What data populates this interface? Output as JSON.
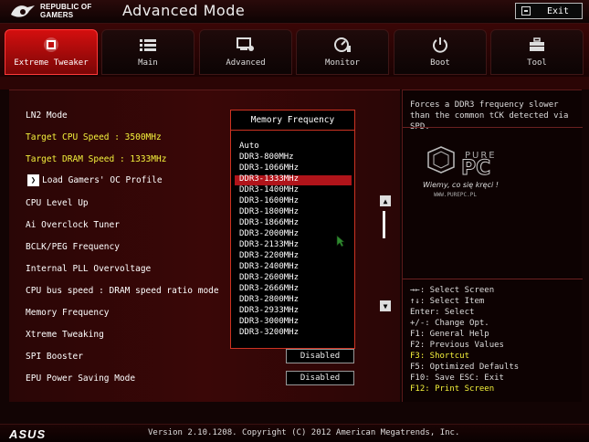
{
  "header": {
    "brand_line1": "REPUBLIC OF",
    "brand_line2": "GAMERS",
    "mode_title": "Advanced Mode",
    "exit_label": "Exit"
  },
  "tabs": [
    {
      "label": "Extreme Tweaker",
      "icon": "cpu-chip-icon",
      "active": true
    },
    {
      "label": "Main",
      "icon": "list-icon"
    },
    {
      "label": "Advanced",
      "icon": "settings-screen-icon"
    },
    {
      "label": "Monitor",
      "icon": "gauge-icon"
    },
    {
      "label": "Boot",
      "icon": "power-icon"
    },
    {
      "label": "Tool",
      "icon": "toolbox-icon"
    }
  ],
  "settings": [
    {
      "label": "LN2 Mode"
    },
    {
      "label": "Target CPU Speed : 3500MHz",
      "highlight": true
    },
    {
      "label": "Target DRAM Speed : 1333MHz",
      "highlight": true
    },
    {
      "label": "Load Gamers' OC Profile",
      "submenu": true
    },
    {
      "label": "CPU Level Up"
    },
    {
      "label": "Ai Overclock Tuner"
    },
    {
      "label": "BCLK/PEG Frequency"
    },
    {
      "label": "Internal PLL Overvoltage"
    },
    {
      "label": "CPU bus speed : DRAM speed ratio mode"
    },
    {
      "label": "Memory Frequency",
      "selected": true
    },
    {
      "label": "Xtreme Tweaking"
    },
    {
      "label": "SPI Booster",
      "value": "Disabled"
    },
    {
      "label": "EPU Power Saving Mode",
      "value": "Disabled"
    }
  ],
  "popup": {
    "title": "Memory Frequency",
    "options": [
      "Auto",
      "DDR3-800MHz",
      "DDR3-1066MHz",
      "DDR3-1333MHz",
      "DDR3-1400MHz",
      "DDR3-1600MHz",
      "DDR3-1800MHz",
      "DDR3-1866MHz",
      "DDR3-2000MHz",
      "DDR3-2133MHz",
      "DDR3-2200MHz",
      "DDR3-2400MHz",
      "DDR3-2600MHz",
      "DDR3-2666MHz",
      "DDR3-2800MHz",
      "DDR3-2933MHz",
      "DDR3-3000MHz",
      "DDR3-3200MHz"
    ],
    "highlighted": "DDR3-1333MHz"
  },
  "help": {
    "description": "Forces a DDR3 frequency slower than the common tCK detected via SPD.",
    "keys": [
      {
        "text": "→←: Select Screen"
      },
      {
        "text": "↑↓: Select Item"
      },
      {
        "text": "Enter: Select"
      },
      {
        "text": "+/-: Change Opt."
      },
      {
        "text": "F1: General Help"
      },
      {
        "text": "F2: Previous Values"
      },
      {
        "text": "F3: Shortcut",
        "highlight": true
      },
      {
        "text": "F5: Optimized Defaults"
      },
      {
        "text": "F10: Save  ESC: Exit"
      },
      {
        "text": "F12: Print Screen",
        "highlight": true
      }
    ]
  },
  "watermark": {
    "logo": "PURE PC",
    "slogan": "Wiemy, co się kręci !",
    "url": "WWW.PUREPC.PL"
  },
  "footer": {
    "brand": "ASUS",
    "version": "Version 2.10.1208. Copyright (C) 2012 American Megatrends, Inc."
  },
  "colors": {
    "accent_red": "#d40f0f",
    "highlight_yellow": "#f5f23c",
    "selection_red": "#b0141a"
  }
}
